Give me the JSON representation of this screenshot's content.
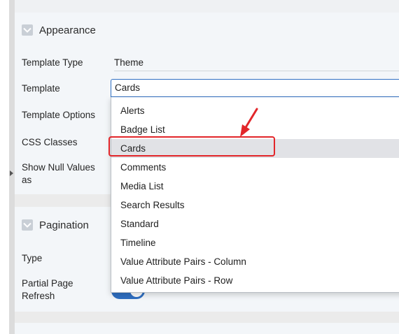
{
  "appearance": {
    "title": "Appearance",
    "fields": {
      "template_type_label": "Template Type",
      "template_type_value": "Theme",
      "template_label": "Template",
      "template_value": "Cards",
      "template_options_label": "Template Options",
      "css_classes_label": "CSS Classes",
      "show_null_line1": "Show Null Values",
      "show_null_line2": "as"
    }
  },
  "dropdown": {
    "options": [
      "Alerts",
      "Badge List",
      "Cards",
      "Comments",
      "Media List",
      "Search Results",
      "Standard",
      "Timeline",
      "Value Attribute Pairs - Column",
      "Value Attribute Pairs - Row"
    ],
    "selected": "Cards"
  },
  "pagination": {
    "title": "Pagination",
    "type_label": "Type",
    "partial_refresh_line1": "Partial Page",
    "partial_refresh_line2": "Refresh",
    "partial_refresh_on": true
  },
  "colors": {
    "accent": "#2f6fc2",
    "annotation": "#e2262a",
    "selected_row": "#e1e2e6"
  },
  "icons": [
    "chevron-down-icon",
    "splitter-handle-icon",
    "annotation-arrow-icon"
  ]
}
